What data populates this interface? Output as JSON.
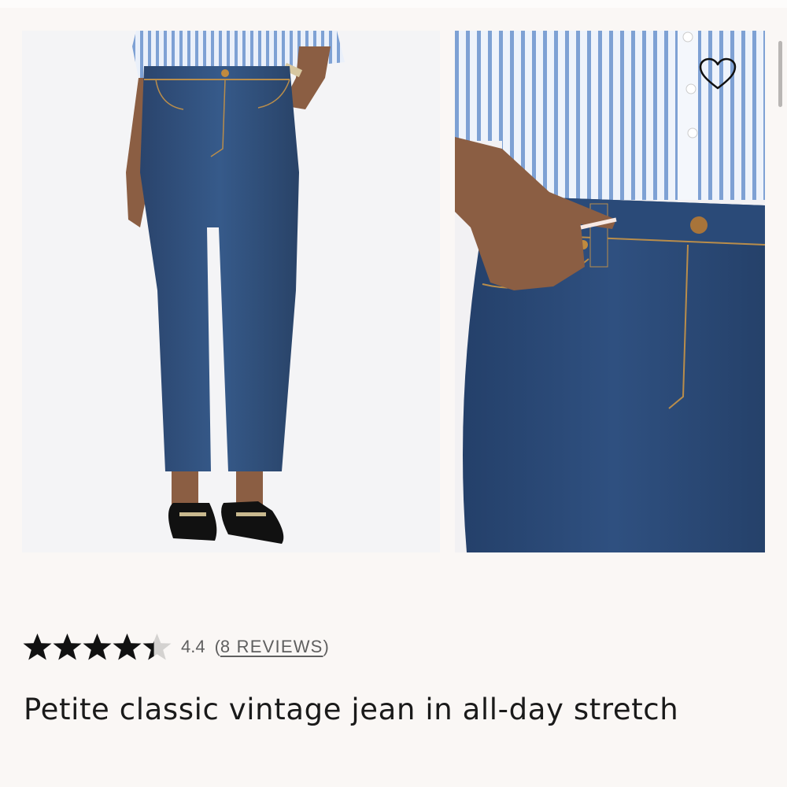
{
  "gallery": {
    "images": [
      {
        "subject": "full-length model wearing dark wash jeans, striped shirt and black loafers"
      },
      {
        "subject": "close-up of high-rise waistband with hand in front pocket"
      }
    ],
    "wishlist_icon": "heart-outline-icon"
  },
  "product": {
    "rating": {
      "value": "4.4",
      "stars": 4.4,
      "max_stars": 5,
      "paren_open": "(",
      "reviews_label": "8 REVIEWS",
      "paren_close": ")"
    },
    "title": "Petite classic vintage jean in all-day stretch"
  },
  "colors": {
    "background": "#faf7f5",
    "star_fill": "#111111",
    "star_empty": "#d4d2d0",
    "text": "#1a1a1a",
    "muted_text": "#5f5f5f",
    "denim": "#2c4a75",
    "shirt_stripe": "#7ea1d4"
  }
}
